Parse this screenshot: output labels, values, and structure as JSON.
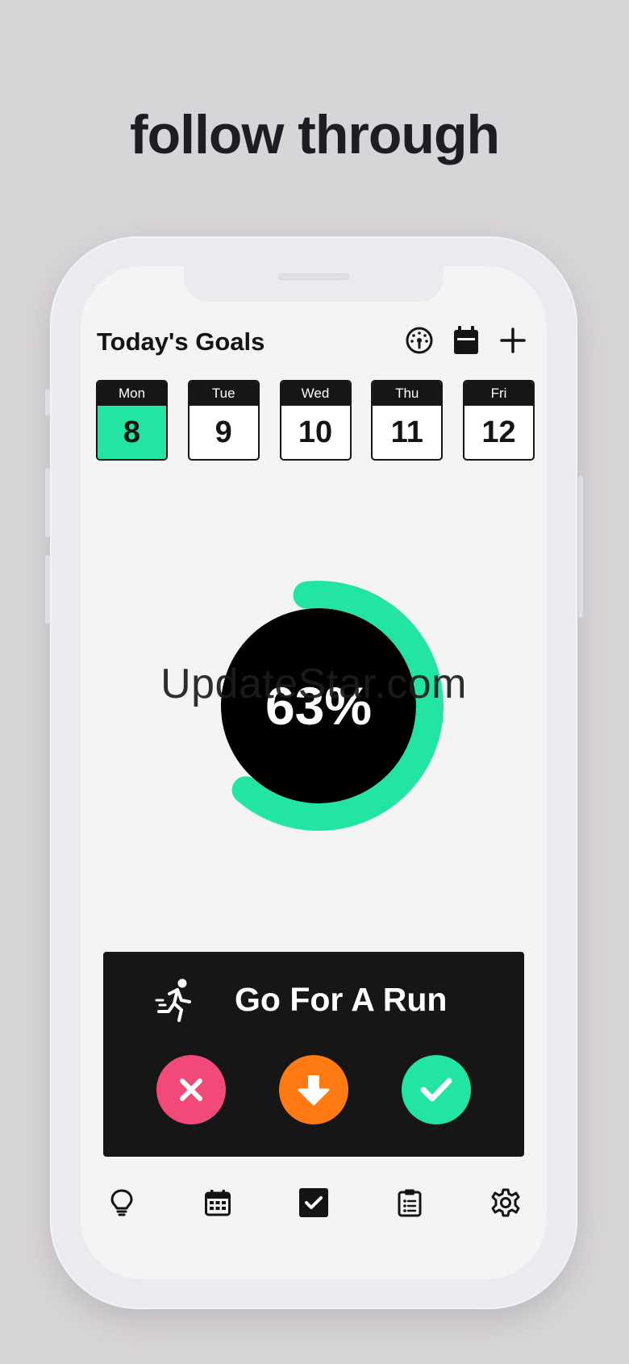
{
  "headline": "follow through",
  "header": {
    "title": "Today's Goals",
    "icons": [
      "speedometer-icon",
      "calendar-icon",
      "plus-icon"
    ]
  },
  "days": [
    {
      "name": "Mon",
      "num": "8",
      "active": true
    },
    {
      "name": "Tue",
      "num": "9",
      "active": false
    },
    {
      "name": "Wed",
      "num": "10",
      "active": false
    },
    {
      "name": "Thu",
      "num": "11",
      "active": false
    },
    {
      "name": "Fri",
      "num": "12",
      "active": false
    }
  ],
  "progress": {
    "label": "63%",
    "value": 63,
    "color": "#22e5a5"
  },
  "watermark": "UpdateStar.com",
  "goal": {
    "title": "Go For A Run",
    "icon": "running-person-icon",
    "actions": [
      {
        "name": "skip",
        "icon": "close-icon",
        "color": "#f24a78"
      },
      {
        "name": "postpone",
        "icon": "arrow-down-icon",
        "color": "#ff7a12"
      },
      {
        "name": "complete",
        "icon": "check-icon",
        "color": "#22e5a5"
      }
    ]
  },
  "tabs": [
    "lightbulb-icon",
    "calendar-grid-icon",
    "checkbox-icon",
    "clipboard-list-icon",
    "gear-icon"
  ],
  "colors": {
    "accent": "#22e5a5",
    "dark": "#161616",
    "background": "#d8d5d8"
  }
}
